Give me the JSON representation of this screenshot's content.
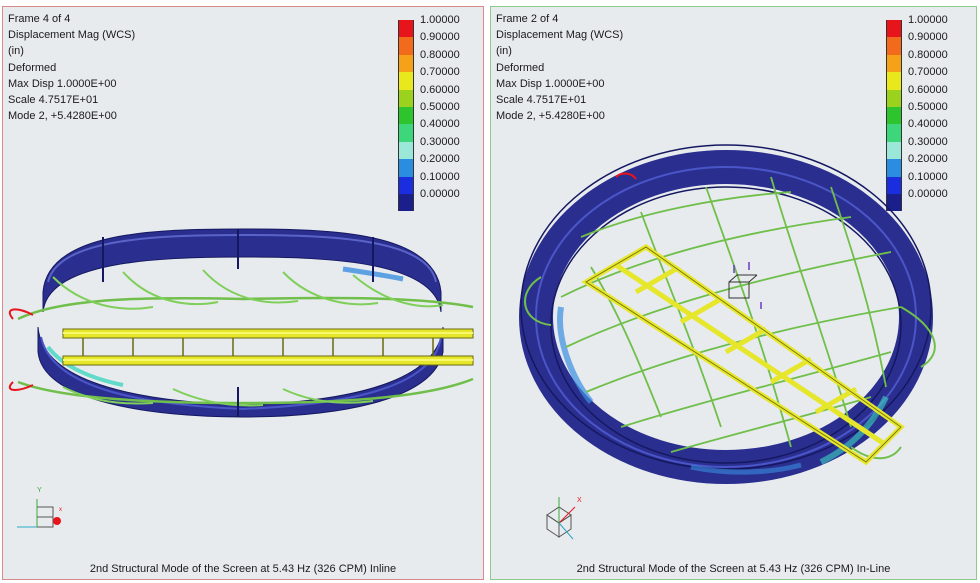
{
  "left_view": {
    "frame": "Frame 4 of 4",
    "result": "Displacement Mag (WCS)",
    "units": "(in)",
    "state": "Deformed",
    "max_disp": "Max Disp  1.0000E+00",
    "scale": "Scale  4.7517E+01",
    "mode": "Mode 2,  +5.4280E+00",
    "caption": "2nd Structural Mode of the Screen at 5.43 Hz (326 CPM) Inline",
    "triad_label": "Y"
  },
  "right_view": {
    "frame": "Frame 2 of 4",
    "result": "Displacement Mag (WCS)",
    "units": "(in)",
    "state": "Deformed",
    "max_disp": "Max Disp  1.0000E+00",
    "scale": "Scale  4.7517E+01",
    "mode": "Mode 2,  +5.4280E+00",
    "caption": "2nd Structural Mode of the Screen at 5.43 Hz (326 CPM) In-Line",
    "triad_label": "X"
  },
  "legend": {
    "ticks": [
      "1.00000",
      "0.90000",
      "0.80000",
      "0.70000",
      "0.60000",
      "0.50000",
      "0.40000",
      "0.30000",
      "0.20000",
      "0.10000",
      "0.00000"
    ],
    "colors": [
      "#e8141c",
      "#f26a1b",
      "#f5a21a",
      "#e8e81c",
      "#9ad21e",
      "#2ec42e",
      "#3ed67a",
      "#9be8d8",
      "#2a8de0",
      "#1a2ee0",
      "#1a1f8c"
    ]
  },
  "palette": {
    "ring": "#2a2f8f",
    "ring_light": "#4a55c8",
    "beam": "#e6e62a",
    "wire": "#6fbf4a",
    "bg": "#e8ebee"
  }
}
